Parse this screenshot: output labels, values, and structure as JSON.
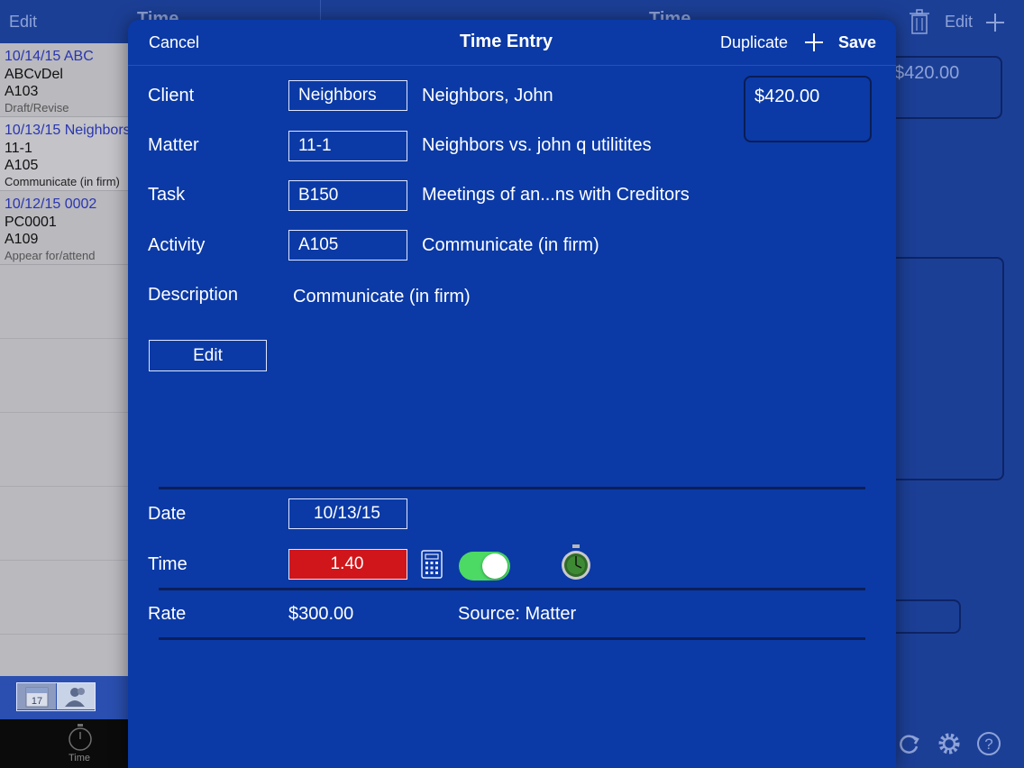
{
  "background": {
    "left_header": {
      "edit_label": "Edit",
      "title": "Time"
    },
    "right_header": {
      "title": "Time",
      "edit_label": "Edit"
    },
    "list_items": [
      {
        "header": "10/14/15  ABC",
        "line2": "ABCvDel",
        "line3": "A103",
        "line4": "Draft/Revise"
      },
      {
        "header": "10/13/15  Neighbors",
        "line2": "11-1",
        "line3": "A105",
        "line4": "Communicate (in firm)"
      },
      {
        "header": "10/12/15  0002",
        "line2": "PC0001",
        "line3": "A109",
        "line4": "Appear for/attend"
      }
    ],
    "amount_ghost": "$420.00",
    "tab_time_label": "Time",
    "calendar_day": "17"
  },
  "modal": {
    "nav": {
      "cancel": "Cancel",
      "title": "Time Entry",
      "duplicate": "Duplicate",
      "save": "Save"
    },
    "client": {
      "label": "Client",
      "code": "Neighbors",
      "name": "Neighbors, John"
    },
    "amount": "$420.00",
    "matter": {
      "label": "Matter",
      "code": "11-1",
      "name": "Neighbors vs. john q utilitites"
    },
    "task": {
      "label": "Task",
      "code": "B150",
      "name": "Meetings of an...ns with Creditors"
    },
    "activity": {
      "label": "Activity",
      "code": "A105",
      "name": "Communicate (in firm)"
    },
    "description": {
      "label": "Description",
      "text": "Communicate (in firm)"
    },
    "edit_button": "Edit",
    "date": {
      "label": "Date",
      "value": "10/13/15"
    },
    "time": {
      "label": "Time",
      "value": "1.40",
      "toggle_on": true
    },
    "rate": {
      "label": "Rate",
      "value": "$300.00",
      "source": "Source: Matter"
    }
  },
  "colors": {
    "modal_bg": "#0b3aa6",
    "time_field_bg": "#d0161a",
    "toggle_on": "#4cd964",
    "list_header_text": "#2a36b0"
  },
  "icons": [
    "trash-icon",
    "plus-icon",
    "calculator-icon",
    "stopwatch-icon",
    "refresh-icon",
    "gear-icon",
    "help-icon",
    "calendar-icon",
    "contacts-icon",
    "timer-icon"
  ]
}
